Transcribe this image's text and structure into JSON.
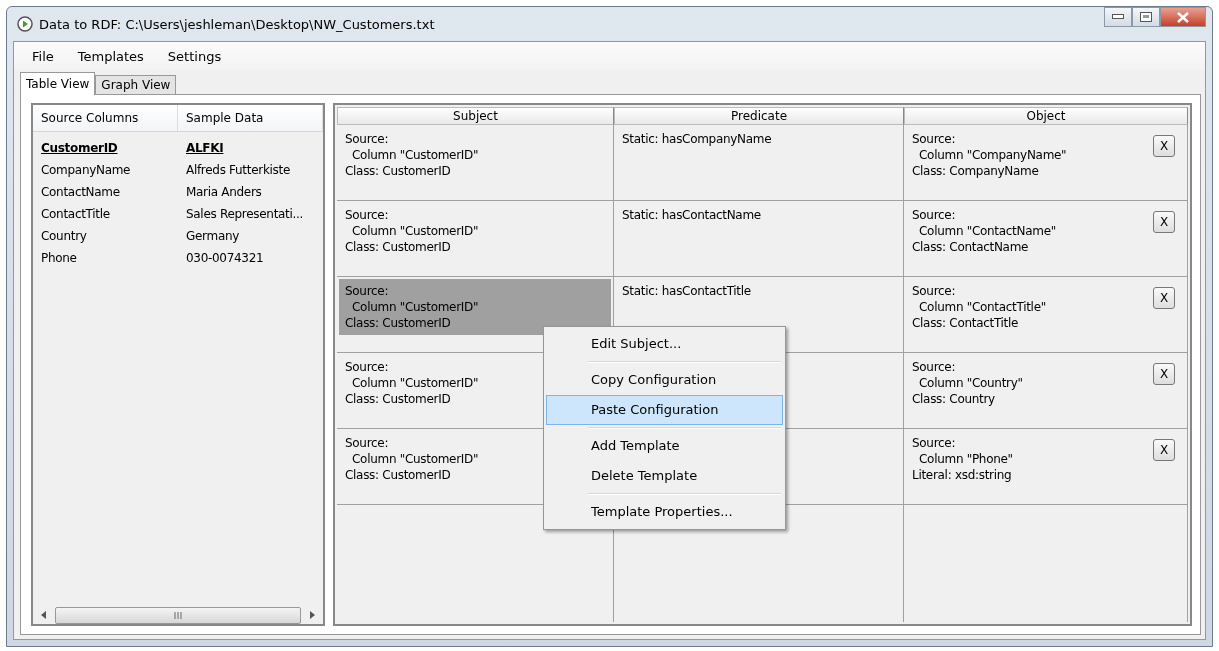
{
  "window": {
    "title": "Data to RDF: C:\\Users\\jeshleman\\Desktop\\NW_Customers.txt"
  },
  "menu_bar": [
    "File",
    "Templates",
    "Settings"
  ],
  "tabs": [
    {
      "label": "Table View",
      "selected": true
    },
    {
      "label": "Graph View",
      "selected": false
    }
  ],
  "source_list": {
    "columns": [
      "Source Columns",
      "Sample Data"
    ],
    "rows": [
      {
        "column": "CustomerID",
        "sample": "ALFKI",
        "key": true
      },
      {
        "column": "CompanyName",
        "sample": "Alfreds Futterkiste",
        "key": false
      },
      {
        "column": "ContactName",
        "sample": "Maria Anders",
        "key": false
      },
      {
        "column": "ContactTitle",
        "sample": "Sales Representati...",
        "key": false
      },
      {
        "column": "Country",
        "sample": "Germany",
        "key": false
      },
      {
        "column": "Phone",
        "sample": "030-0074321",
        "key": false
      }
    ]
  },
  "mapping_grid": {
    "columns": [
      "Subject",
      "Predicate",
      "Object"
    ],
    "rows": [
      {
        "subject": "Source:\n  Column \"CustomerID\"\nClass: CustomerID",
        "selected": false,
        "predicate": "Static: hasCompanyName",
        "object": "Source:\n  Column \"CompanyName\"\nClass: CompanyName",
        "delete": "X"
      },
      {
        "subject": "Source:\n  Column \"CustomerID\"\nClass: CustomerID",
        "selected": false,
        "predicate": "Static: hasContactName",
        "object": "Source:\n  Column \"ContactName\"\nClass: ContactName",
        "delete": "X"
      },
      {
        "subject": "Source:\n  Column \"CustomerID\"\nClass: CustomerID",
        "selected": true,
        "predicate": "Static: hasContactTitle",
        "object": "Source:\n  Column \"ContactTitle\"\nClass: ContactTitle",
        "delete": "X"
      },
      {
        "subject": "Source:\n  Column \"CustomerID\"\nClass: CustomerID",
        "selected": false,
        "object": "Source:\n  Column \"Country\"\nClass: Country",
        "delete": "X"
      },
      {
        "subject": "Source:\n  Column \"CustomerID\"\nClass: CustomerID",
        "selected": false,
        "object": "Source:\n  Column \"Phone\"\nLiteral: xsd:string",
        "delete": "X"
      }
    ]
  },
  "context_menu": [
    {
      "label": "Edit Subject...",
      "selected": false,
      "separator_after": true
    },
    {
      "label": "Copy Configuration",
      "selected": false,
      "separator_after": false
    },
    {
      "label": "Paste Configuration",
      "selected": true,
      "separator_after": true
    },
    {
      "label": "Add Template",
      "selected": false,
      "separator_after": false
    },
    {
      "label": "Delete Template",
      "selected": false,
      "separator_after": true
    },
    {
      "label": "Template Properties...",
      "selected": false,
      "separator_after": false
    }
  ]
}
